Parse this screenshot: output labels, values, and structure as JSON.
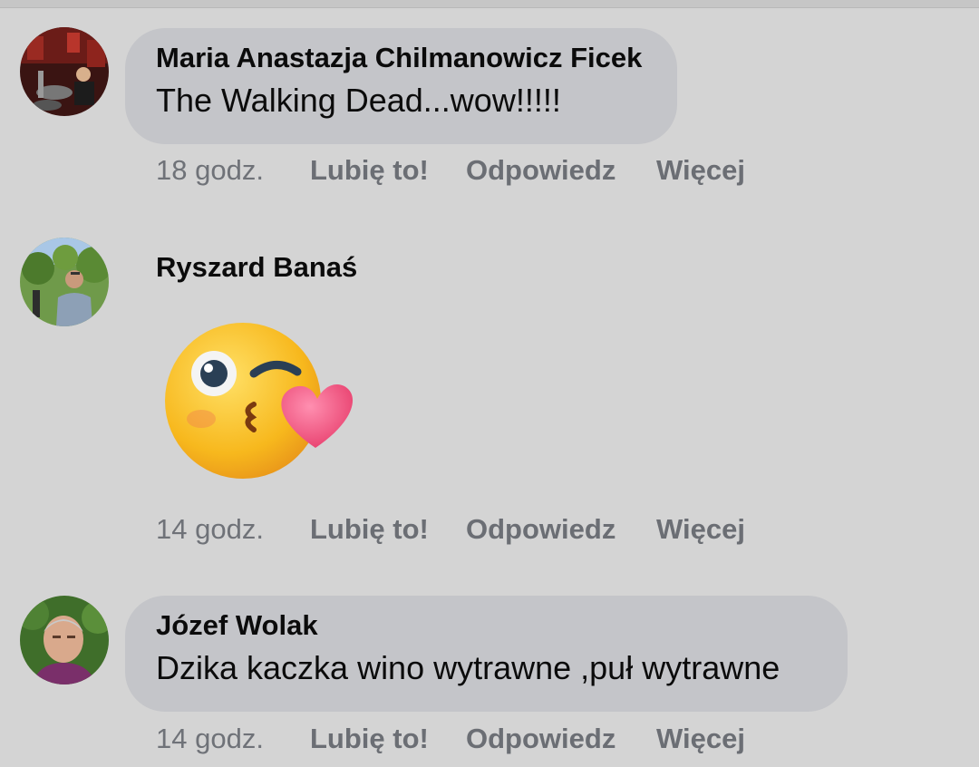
{
  "comments": [
    {
      "author": "Maria Anastazja Chilmanowicz Ficek",
      "text": "The Walking Dead...wow!!!!!",
      "time": "18 godz.",
      "like": "Lubię to!",
      "reply": "Odpowiedz",
      "more": "Więcej"
    },
    {
      "author": "Ryszard Banaś",
      "sticker": "kissing-face-sticker",
      "time": "14 godz.",
      "like": "Lubię to!",
      "reply": "Odpowiedz",
      "more": "Więcej"
    },
    {
      "author": "Józef Wolak",
      "text": "Dzika kaczka wino wytrawne ,puł wytrawne",
      "time": "14 godz.",
      "like": "Lubię to!",
      "reply": "Odpowiedz",
      "more": "Więcej"
    }
  ],
  "colors": {
    "background": "#d4d4d4",
    "bubble": "#c4c5c9",
    "meta": "#6b6e74"
  }
}
